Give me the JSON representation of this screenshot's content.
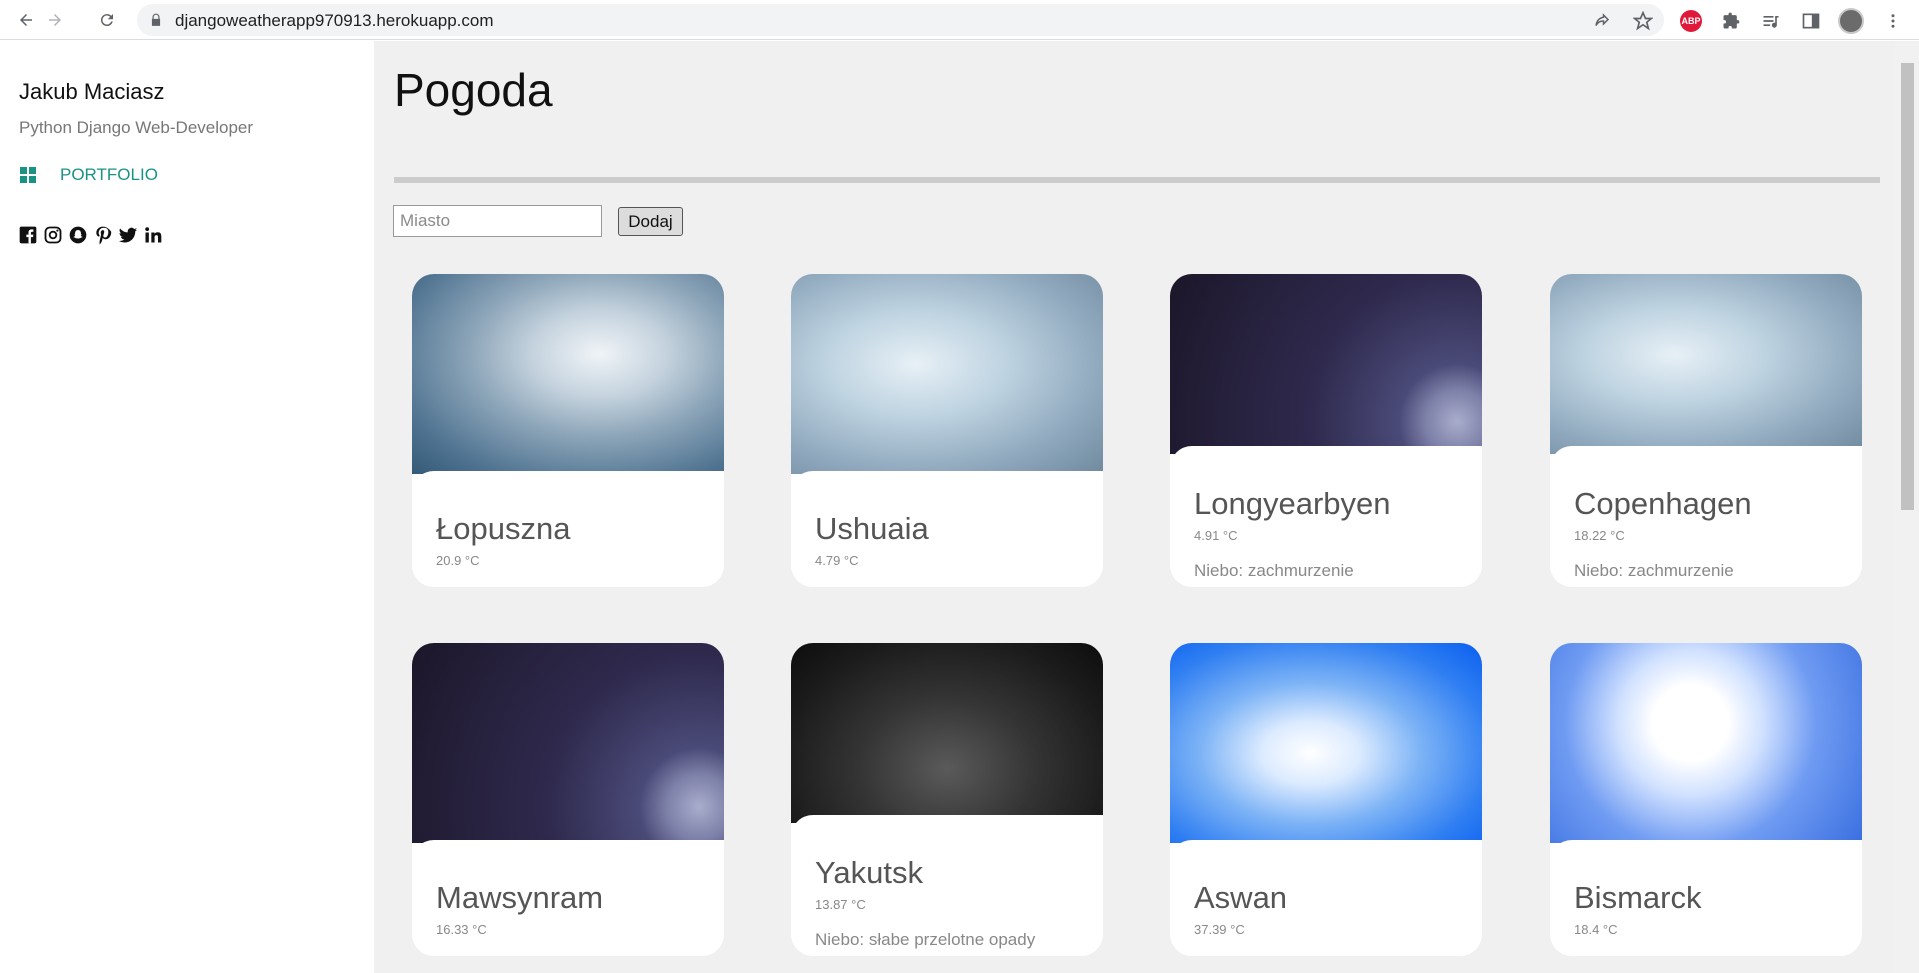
{
  "browser": {
    "url": "djangoweatherapp970913.herokuapp.com",
    "abp_label": "ABP"
  },
  "sidebar": {
    "name": "Jakub Maciasz",
    "role": "Python Django Web-Developer",
    "portfolio_label": "PORTFOLIO",
    "socials": [
      "facebook-icon",
      "instagram-icon",
      "snapchat-icon",
      "pinterest-icon",
      "twitter-icon",
      "linkedin-icon"
    ]
  },
  "main": {
    "title": "Pogoda",
    "city_placeholder": "Miasto",
    "add_label": "Dodaj"
  },
  "cards": [
    {
      "city": "Łopuszna",
      "temp": "20.9 °C",
      "desc": "",
      "sky": "cloudy"
    },
    {
      "city": "Ushuaia",
      "temp": "4.79 °C",
      "desc": "",
      "sky": "cloudy"
    },
    {
      "city": "Longyearbyen",
      "temp": "4.91 °C",
      "desc": "Niebo: zachmurzenie",
      "sky": "night"
    },
    {
      "city": "Copenhagen",
      "temp": "18.22 °C",
      "desc": "Niebo: zachmurzenie",
      "sky": "cloudy"
    },
    {
      "city": "Mawsynram",
      "temp": "16.33 °C",
      "desc": "",
      "sky": "night"
    },
    {
      "city": "Yakutsk",
      "temp": "13.87 °C",
      "desc": "Niebo: słabe przelotne opady",
      "sky": "dark"
    },
    {
      "city": "Aswan",
      "temp": "37.39 °C",
      "desc": "",
      "sky": "clear"
    },
    {
      "city": "Bismarck",
      "temp": "18.4 °C",
      "desc": "",
      "sky": "sun"
    }
  ]
}
